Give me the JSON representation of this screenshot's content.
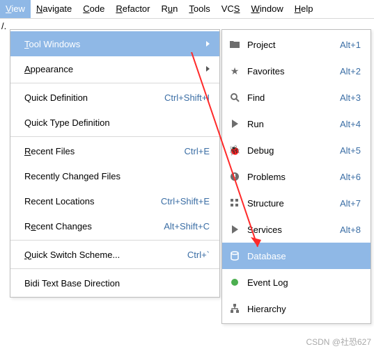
{
  "menubar": {
    "view": {
      "pre": "V",
      "u": "̲",
      "rest": "iew",
      "label": "View",
      "mn": "V"
    },
    "items": [
      {
        "label": "View",
        "mn": "V"
      },
      {
        "label": "Navigate",
        "mn": "N"
      },
      {
        "label": "Code",
        "mn": "C"
      },
      {
        "label": "Refactor",
        "mn": "R"
      },
      {
        "label": "Run",
        "mn": "u",
        "pre": "R"
      },
      {
        "label": "Tools",
        "mn": "T"
      },
      {
        "label": "VCS",
        "mn": "S",
        "pre": "VC"
      },
      {
        "label": "Window",
        "mn": "W"
      },
      {
        "label": "Help",
        "mn": "H"
      }
    ]
  },
  "dropdown": {
    "items": [
      {
        "label": "Tool Windows",
        "mn": "T",
        "submenu": true,
        "selected": true
      },
      {
        "label": "Appearance",
        "mn": "A",
        "submenu": true
      },
      "sep",
      {
        "label": "Quick Definition",
        "mn": "",
        "shortcut": "Ctrl+Shift+I"
      },
      {
        "label": "Quick Type Definition",
        "mn": ""
      },
      "sep",
      {
        "label": "Recent Files",
        "mn": "R",
        "shortcut": "Ctrl+E"
      },
      {
        "label": "Recently Changed Files",
        "mn": ""
      },
      {
        "label": "Recent Locations",
        "mn": "",
        "shortcut": "Ctrl+Shift+E"
      },
      {
        "label": "Recent Changes",
        "mn": "e",
        "pre": "R",
        "shortcut": "Alt+Shift+C"
      },
      "sep",
      {
        "label": "Quick Switch Scheme...",
        "mn": "Q",
        "shortcut": "Ctrl+`"
      },
      "sep",
      {
        "label": "Bidi Text Base Direction",
        "mn": ""
      }
    ]
  },
  "submenu": {
    "items": [
      {
        "icon": "folder",
        "label": "Project",
        "shortcut": "Alt+1"
      },
      {
        "icon": "star",
        "label": "Favorites",
        "shortcut": "Alt+2"
      },
      {
        "icon": "search",
        "label": "Find",
        "shortcut": "Alt+3"
      },
      {
        "icon": "play",
        "label": "Run",
        "shortcut": "Alt+4"
      },
      {
        "icon": "bug",
        "label": "Debug",
        "shortcut": "Alt+5"
      },
      {
        "icon": "warn",
        "label": "Problems",
        "shortcut": "Alt+6"
      },
      {
        "icon": "struct",
        "label": "Structure",
        "shortcut": "Alt+7"
      },
      {
        "icon": "services",
        "label": "Services",
        "shortcut": "Alt+8"
      },
      {
        "icon": "db",
        "label": "Database",
        "selected": true
      },
      {
        "icon": "eventlog",
        "label": "Event Log"
      },
      {
        "icon": "hierarchy",
        "label": "Hierarchy"
      }
    ]
  },
  "watermark": "CSDN @社恐627"
}
